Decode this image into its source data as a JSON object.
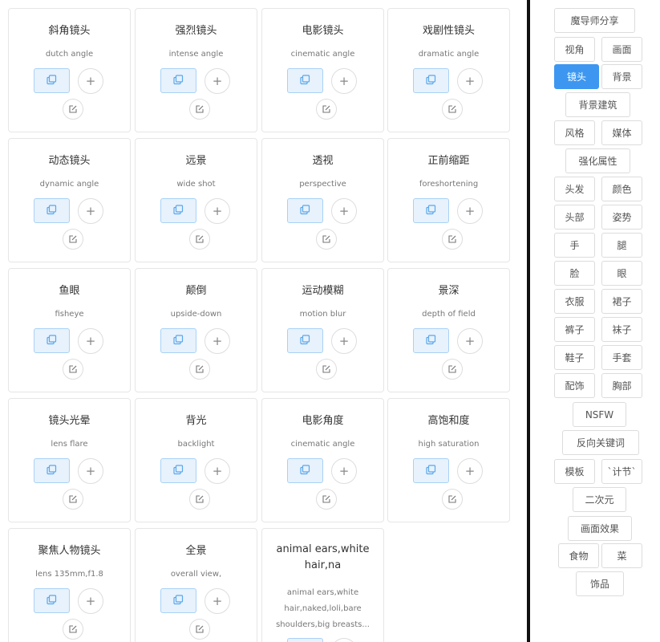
{
  "cards": [
    {
      "title": "斜角镜头",
      "sub": "dutch angle"
    },
    {
      "title": "强烈镜头",
      "sub": "intense angle"
    },
    {
      "title": "电影镜头",
      "sub": "cinematic angle"
    },
    {
      "title": "戏剧性镜头",
      "sub": "dramatic angle"
    },
    {
      "title": "动态镜头",
      "sub": "dynamic angle"
    },
    {
      "title": "远景",
      "sub": "wide shot"
    },
    {
      "title": "透视",
      "sub": "perspective"
    },
    {
      "title": "正前缩距",
      "sub": "foreshortening"
    },
    {
      "title": "鱼眼",
      "sub": "fisheye"
    },
    {
      "title": "颠倒",
      "sub": "upside-down"
    },
    {
      "title": "运动模糊",
      "sub": "motion blur"
    },
    {
      "title": "景深",
      "sub": "depth of field"
    },
    {
      "title": "镜头光晕",
      "sub": "lens flare"
    },
    {
      "title": "背光",
      "sub": "backlight"
    },
    {
      "title": "电影角度",
      "sub": "cinematic angle"
    },
    {
      "title": "高饱和度",
      "sub": "high saturation"
    },
    {
      "title": "聚焦人物镜头",
      "sub": "lens 135mm,f1.8"
    },
    {
      "title": "全景",
      "sub": "overall view,"
    },
    {
      "title": "animal ears,white hair,na",
      "sub": "animal ears,white hair,naked,loli,bare shoulders,big breasts..."
    }
  ],
  "card_buttons": {
    "add_symbol": "+"
  },
  "tags": [
    {
      "label": "魔导师分享",
      "active": false
    },
    {
      "label": "视角",
      "active": false
    },
    {
      "label": "画面",
      "active": false
    },
    {
      "label": "镜头",
      "active": true
    },
    {
      "label": "背景",
      "active": false
    },
    {
      "label": "背景建筑",
      "active": false
    },
    {
      "label": "风格",
      "active": false
    },
    {
      "label": "媒体",
      "active": false
    },
    {
      "label": "强化属性",
      "active": false
    },
    {
      "label": "头发",
      "active": false
    },
    {
      "label": "颜色",
      "active": false
    },
    {
      "label": "头部",
      "active": false
    },
    {
      "label": "姿势",
      "active": false
    },
    {
      "label": "手",
      "active": false
    },
    {
      "label": "腿",
      "active": false
    },
    {
      "label": "脸",
      "active": false
    },
    {
      "label": "眼",
      "active": false
    },
    {
      "label": "衣服",
      "active": false
    },
    {
      "label": "裙子",
      "active": false
    },
    {
      "label": "裤子",
      "active": false
    },
    {
      "label": "袜子",
      "active": false
    },
    {
      "label": "鞋子",
      "active": false
    },
    {
      "label": "手套",
      "active": false
    },
    {
      "label": "配饰",
      "active": false
    },
    {
      "label": "胸部",
      "active": false
    },
    {
      "label": "NSFW",
      "active": false
    },
    {
      "label": "反向关键词",
      "active": false
    },
    {
      "label": "模板",
      "active": false
    },
    {
      "label": "`计节`",
      "active": false
    },
    {
      "label": "二次元",
      "active": false
    },
    {
      "label": "画面效果",
      "active": false
    },
    {
      "label": "食物",
      "active": false
    },
    {
      "label": "菜",
      "active": false
    },
    {
      "label": "饰品",
      "active": false
    }
  ],
  "colors": {
    "accent": "#3d97f0",
    "copy_bg": "#e7f2fc",
    "copy_border": "#a9d2f5"
  },
  "icons": {
    "copy": "copy-icon",
    "add": "plus-icon",
    "edit": "edit-icon"
  }
}
